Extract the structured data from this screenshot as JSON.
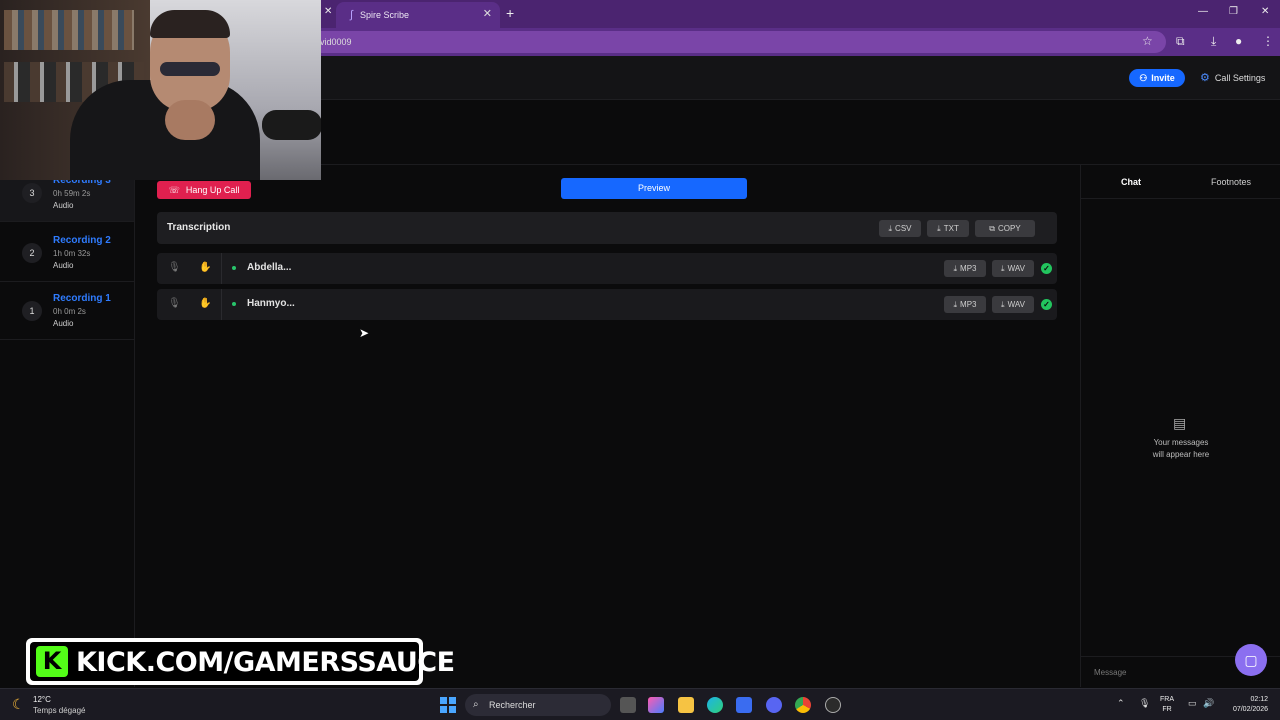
{
  "browser": {
    "tab_title": "Spire Scribe",
    "url_fragment": "vid0009",
    "new_tab_icon": "plus-icon"
  },
  "header": {
    "invite_label": "Invite",
    "call_settings_label": "Call Settings"
  },
  "sidebar": {
    "recordings": [
      {
        "num": "3",
        "title": "Recording 3",
        "duration": "0h 59m 2s",
        "type": "Audio"
      },
      {
        "num": "2",
        "title": "Recording 2",
        "duration": "1h 0m 32s",
        "type": "Audio"
      },
      {
        "num": "1",
        "title": "Recording 1",
        "duration": "0h 0m 2s",
        "type": "Audio"
      }
    ]
  },
  "main": {
    "hangup_label": "Hang Up Call",
    "preview_label": "Preview",
    "transcription_title": "Transcription",
    "export": {
      "csv": "CSV",
      "txt": "TXT",
      "copy": "COPY"
    },
    "participants": [
      {
        "name": "Abdella...",
        "mp3": "MP3",
        "wav": "WAV"
      },
      {
        "name": "Hanmyo...",
        "mp3": "MP3",
        "wav": "WAV"
      }
    ]
  },
  "right": {
    "tab_chat": "Chat",
    "tab_footnotes": "Footnotes",
    "empty_line1": "Your messages",
    "empty_line2": "will appear here",
    "message_placeholder": "Message"
  },
  "overlay": {
    "kick_text": "KICK.COM/GAMERSSAUCE",
    "kick_logo": "K"
  },
  "taskbar": {
    "temp": "12°C",
    "weather": "Temps dégagé",
    "search": "Rechercher",
    "lang1": "FRA",
    "lang2": "FR",
    "time": "02:12",
    "date": "07/02/2026"
  },
  "colors": {
    "accent_blue": "#1668ff",
    "hangup_red": "#e0204f",
    "tab_purple": "#5a2e87",
    "status_green": "#22c55e"
  }
}
